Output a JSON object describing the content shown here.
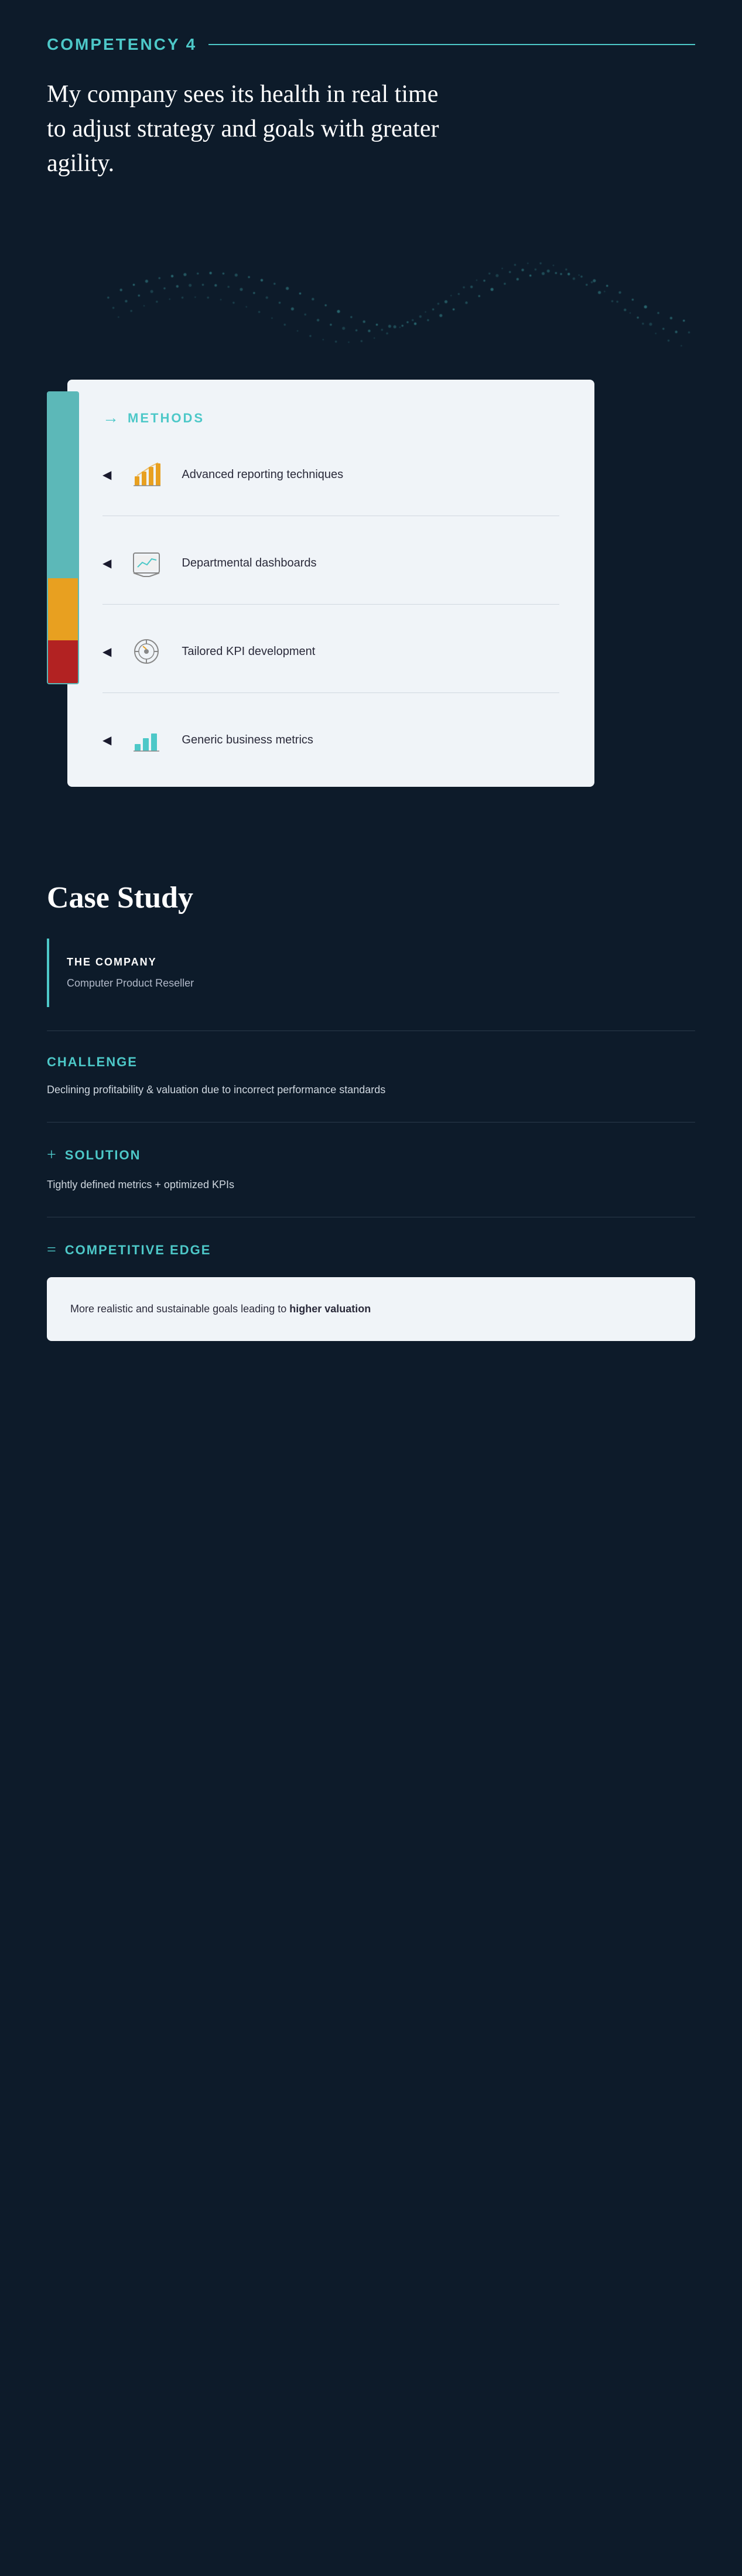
{
  "hero": {
    "competency_label": "COMPETENCY",
    "competency_number": "4",
    "description": "My company sees its health in real time to adjust strategy and goals with greater agility."
  },
  "methods": {
    "title": "METHODS",
    "items": [
      {
        "id": 1,
        "label": "Advanced reporting techniques",
        "icon": "bar-chart"
      },
      {
        "id": 2,
        "label": "Departmental dashboards",
        "icon": "dashboard"
      },
      {
        "id": 3,
        "label": "Tailored KPI development",
        "icon": "kpi"
      },
      {
        "id": 4,
        "label": "Generic business metrics",
        "icon": "metrics"
      }
    ]
  },
  "case_study": {
    "title": "Case Study",
    "company": {
      "label": "THE COMPANY",
      "value": "Computer Product Reseller"
    },
    "challenge": {
      "label": "CHALLENGE",
      "text": "Declining profitability & valuation due to incorrect performance standards"
    },
    "solution": {
      "label": "SOLUTION",
      "prefix": "+",
      "text": "Tightly defined metrics + optimized KPIs"
    },
    "competitive_edge": {
      "label": "COMPETITIVE EDGE",
      "prefix": "=",
      "text": "More realistic and sustainable goals leading to ",
      "text_bold": "higher valuation"
    }
  },
  "colors": {
    "teal": "#4dc8c8",
    "dark_bg": "#0d1b2a",
    "card_bg": "#f0f4f8",
    "bar_teal": "#5cb8b8",
    "bar_yellow": "#e8a020",
    "bar_red": "#b22222"
  }
}
